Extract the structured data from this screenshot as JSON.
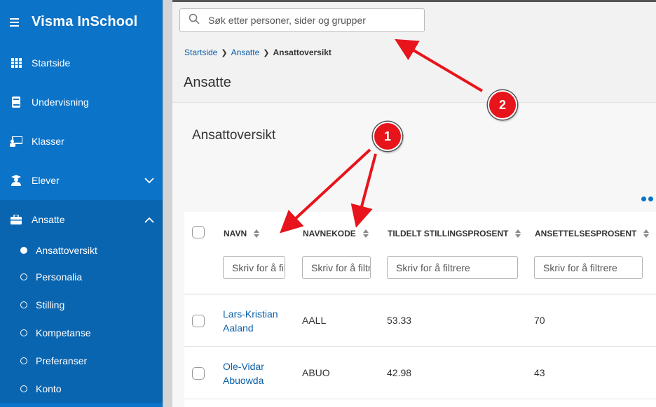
{
  "app": {
    "title": "Visma InSchool"
  },
  "sidebar": {
    "items": [
      {
        "label": "Startside",
        "icon": "grid-icon"
      },
      {
        "label": "Undervisning",
        "icon": "book-icon"
      },
      {
        "label": "Klasser",
        "icon": "classroom-icon"
      },
      {
        "label": "Elever",
        "icon": "student-icon",
        "expandable": true
      },
      {
        "label": "Ansatte",
        "icon": "briefcase-icon",
        "expanded": true
      }
    ],
    "subitems": [
      {
        "label": "Ansattoversikt",
        "selected": true
      },
      {
        "label": "Personalia"
      },
      {
        "label": "Stilling"
      },
      {
        "label": "Kompetanse"
      },
      {
        "label": "Preferanser"
      },
      {
        "label": "Konto"
      }
    ]
  },
  "search": {
    "placeholder": "Søk etter personer, sider og grupper"
  },
  "breadcrumb": {
    "items": [
      "Startside",
      "Ansatte"
    ],
    "current": "Ansattoversikt"
  },
  "page": {
    "title": "Ansatte"
  },
  "card": {
    "title": "Ansattoversikt"
  },
  "table": {
    "columns": [
      {
        "label": "NAVN",
        "filter_placeholder": "Skriv for å filtrere"
      },
      {
        "label": "NAVNEKODE",
        "filter_placeholder": "Skriv for å filtrere"
      },
      {
        "label": "TILDELT STILLINGSPROSENT",
        "filter_placeholder": "Skriv for å filtrere"
      },
      {
        "label": "ANSETTELSESPROSENT",
        "filter_placeholder": "Skriv for å filtrere"
      }
    ],
    "rows": [
      {
        "name_line1": "Lars-Kristian",
        "name_line2": "Aaland",
        "code": "AALL",
        "assigned": "53.33",
        "employment": "70"
      },
      {
        "name_line1": "Ole-Vidar",
        "name_line2": "Abuowda",
        "code": "ABUO",
        "assigned": "42.98",
        "employment": "43"
      }
    ]
  },
  "annotations": {
    "badge1": "1",
    "badge2": "2",
    "color": "#e8141b"
  },
  "colors": {
    "sidebar": "#0b73c8",
    "link": "#0a5fa8"
  }
}
